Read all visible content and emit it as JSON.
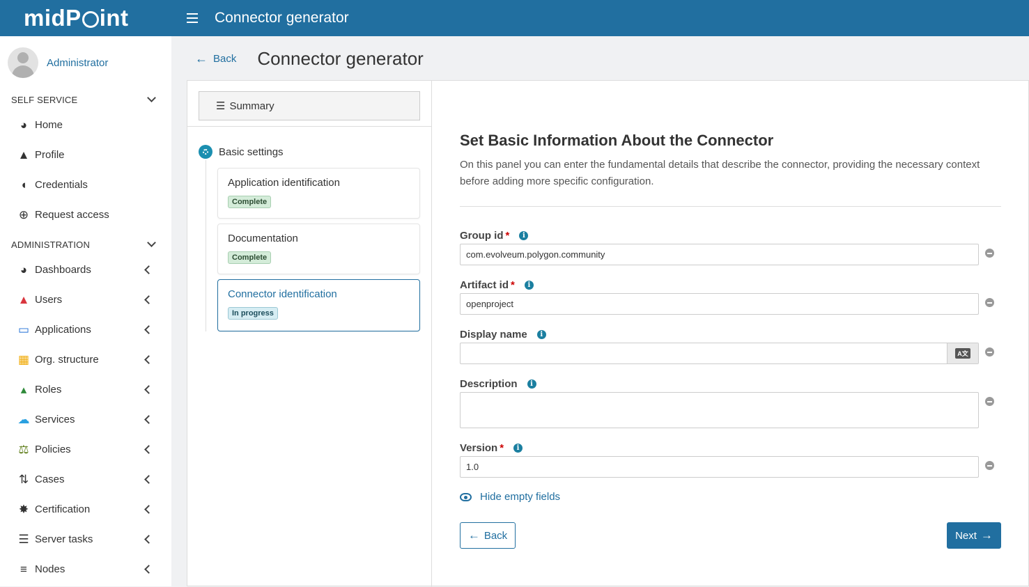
{
  "app": {
    "logo_text_1": "midP",
    "logo_text_2": "int",
    "title": "Connector generator"
  },
  "user": {
    "name": "Administrator"
  },
  "sidebar": {
    "self_service_label": "SELF SERVICE",
    "self_service_items": [
      {
        "label": "Home",
        "icon": "palette-icon",
        "color": "#333"
      },
      {
        "label": "Profile",
        "icon": "user-icon",
        "color": "#333"
      },
      {
        "label": "Credentials",
        "icon": "shield-icon",
        "color": "#333"
      },
      {
        "label": "Request access",
        "icon": "plus-circle-icon",
        "color": "#333"
      }
    ],
    "administration_label": "ADMINISTRATION",
    "admin_items": [
      {
        "label": "Dashboards",
        "icon": "palette-icon",
        "color": "#333"
      },
      {
        "label": "Users",
        "icon": "user-icon",
        "color": "#d9363e"
      },
      {
        "label": "Applications",
        "icon": "monitor-icon",
        "color": "#1f6fd6"
      },
      {
        "label": "Org. structure",
        "icon": "building-icon",
        "color": "#f0a800"
      },
      {
        "label": "Roles",
        "icon": "role-icon",
        "color": "#2f8a3a"
      },
      {
        "label": "Services",
        "icon": "cloud-icon",
        "color": "#2aa0e0"
      },
      {
        "label": "Policies",
        "icon": "scale-icon",
        "color": "#5a7a14"
      },
      {
        "label": "Cases",
        "icon": "cases-icon",
        "color": "#333"
      },
      {
        "label": "Certification",
        "icon": "certificate-icon",
        "color": "#333"
      },
      {
        "label": "Server tasks",
        "icon": "list-check-icon",
        "color": "#333"
      },
      {
        "label": "Nodes",
        "icon": "server-icon",
        "color": "#333"
      }
    ]
  },
  "header": {
    "back_label": "Back",
    "title": "Connector generator"
  },
  "steps_panel": {
    "summary_label": "Summary",
    "group_label": "Basic settings",
    "steps": [
      {
        "title": "Application identification",
        "status": "Complete"
      },
      {
        "title": "Documentation",
        "status": "Complete"
      },
      {
        "title": "Connector identification",
        "status": "In progress"
      }
    ]
  },
  "form": {
    "heading": "Set Basic Information About the Connector",
    "description": "On this panel you can enter the fundamental details that describe the connector, providing the necessary context before adding more specific configuration.",
    "fields": {
      "group_id": {
        "label": "Group id",
        "value": "com.evolveum.polygon.community"
      },
      "artifact_id": {
        "label": "Artifact id",
        "value": "openproject"
      },
      "display_name": {
        "label": "Display name",
        "value": ""
      },
      "description": {
        "label": "Description",
        "value": ""
      },
      "version": {
        "label": "Version",
        "value": "1.0"
      }
    },
    "required_mark": "*",
    "info_glyph": "i",
    "lang_button_label": "A文",
    "hide_empty_label": "Hide empty fields",
    "back_label": "Back",
    "next_label": "Next"
  }
}
